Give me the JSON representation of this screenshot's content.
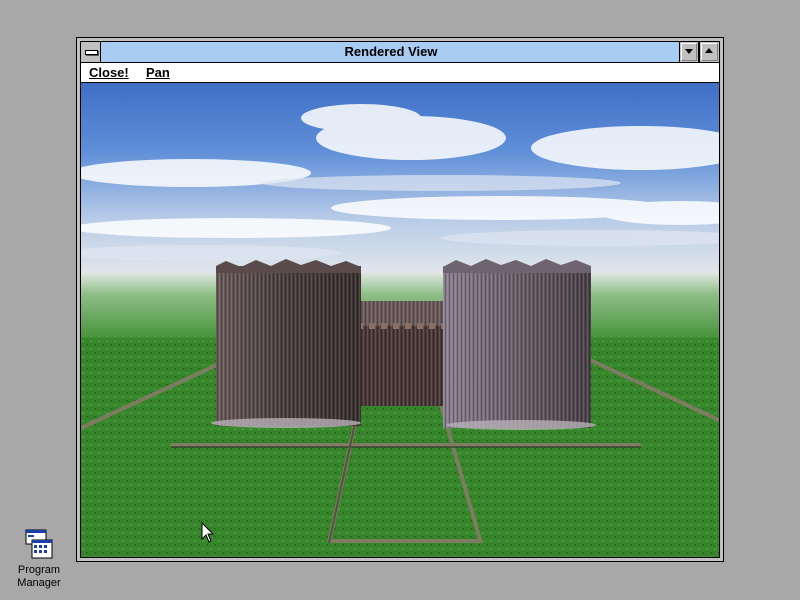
{
  "window": {
    "title": "Rendered View",
    "menu": [
      {
        "label": "Close!"
      },
      {
        "label": "Pan"
      }
    ]
  },
  "desktop": {
    "icon_label": "Program Manager",
    "background": "#a8a8a8"
  },
  "colors": {
    "titlebar": "#a9cdf2",
    "grass": "#3d8a2e",
    "wall": "#4b4040"
  }
}
